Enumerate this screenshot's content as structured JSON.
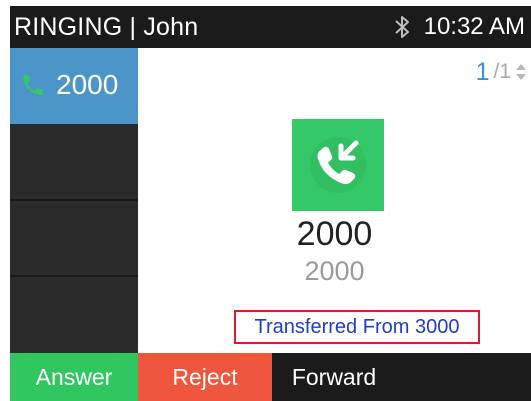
{
  "status_bar": {
    "title": "RINGING | John",
    "time": "10:32 AM",
    "bluetooth_icon": "bluetooth-icon"
  },
  "lines": [
    {
      "number": "2000",
      "active": true,
      "icon": "phone-icon"
    }
  ],
  "pager": {
    "current": "1",
    "separator": "/",
    "total": "1",
    "icon": "up-down-arrows-icon"
  },
  "call": {
    "icon": "incoming-call-icon",
    "caller_name": "2000",
    "caller_number": "2000",
    "transfer_info": "Transferred From 3000"
  },
  "softkeys": {
    "answer": "Answer",
    "reject": "Reject",
    "forward": "Forward"
  },
  "colors": {
    "answer": "#31c760",
    "reject": "#f0553d",
    "active_line": "#4b95c9",
    "call_tile": "#34c868",
    "transfer_text": "#1f3dc8",
    "highlight_border": "#e0192a"
  }
}
